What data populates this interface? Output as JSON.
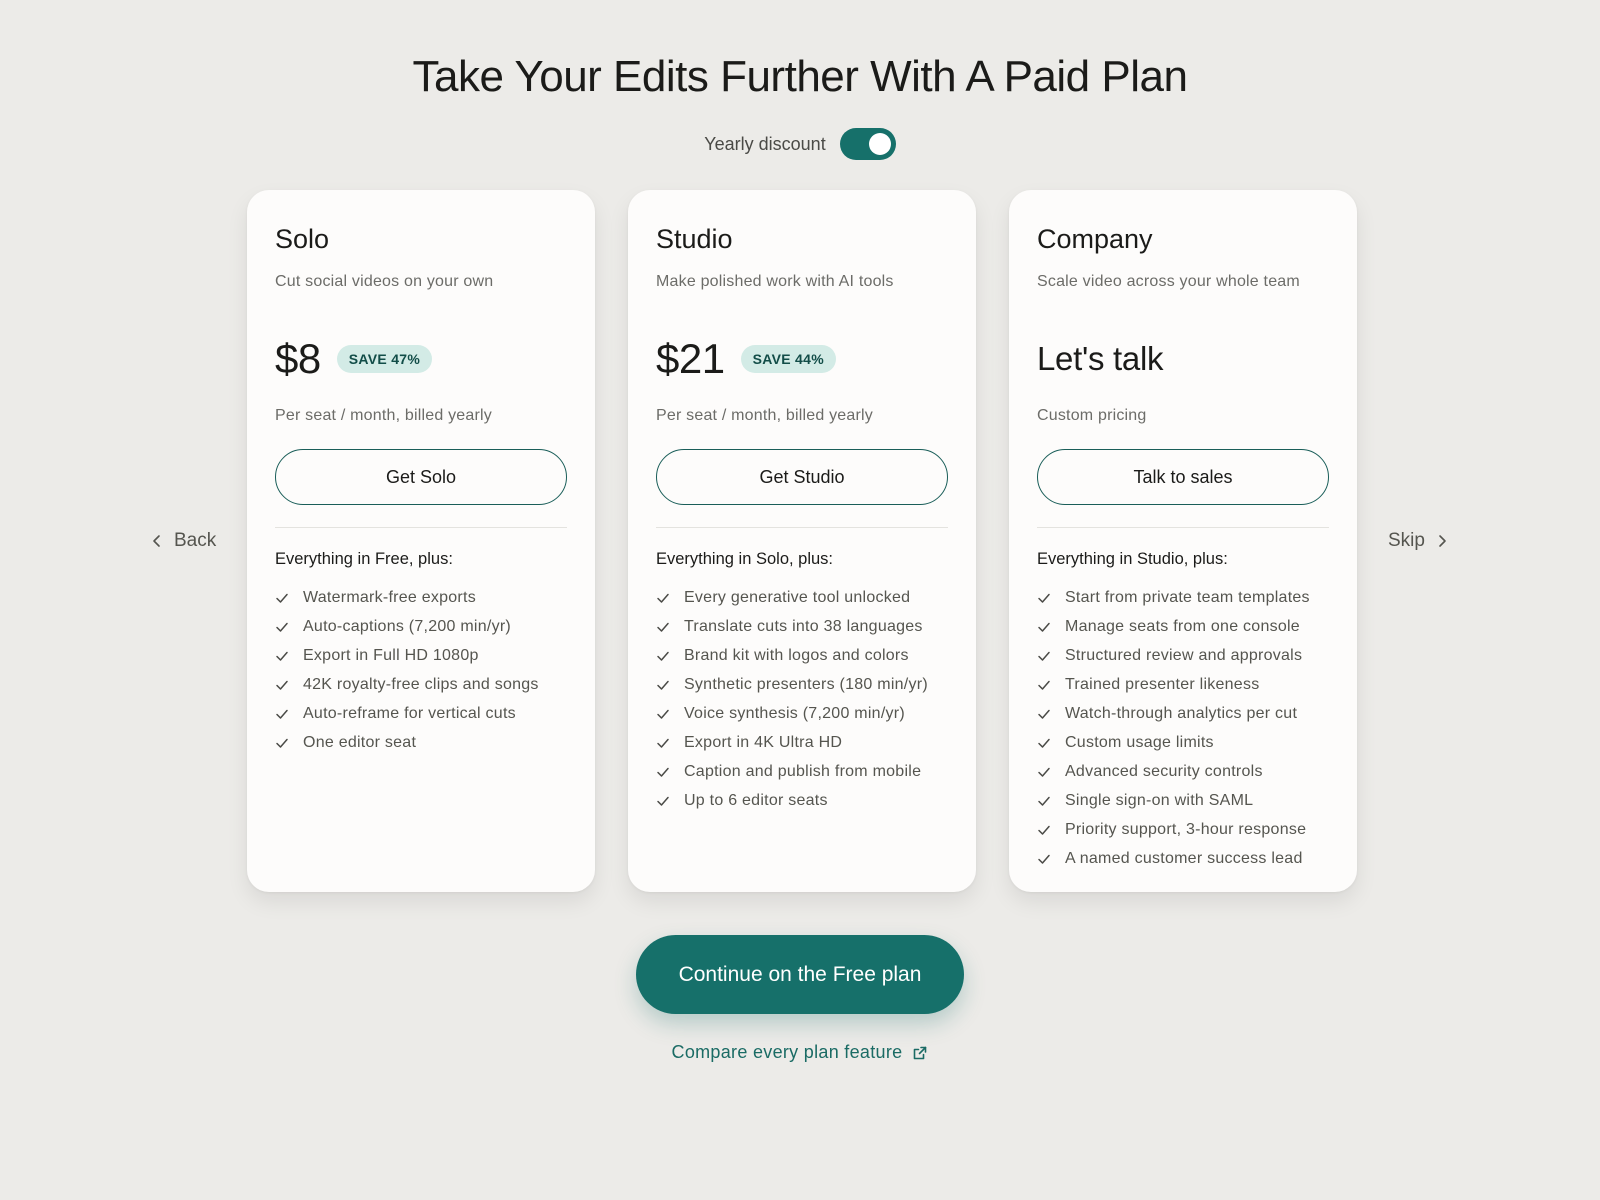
{
  "page": {
    "title": "Take Your Edits Further With A Paid Plan",
    "toggle_label": "Yearly discount",
    "toggle_on": true,
    "accent_color": "#16706a"
  },
  "plans": [
    {
      "name": "Solo",
      "description": "Cut social videos on your own",
      "price": "$8",
      "save_badge": "SAVE 47%",
      "billing": "Per seat / month, billed yearly",
      "cta": "Get Solo",
      "includes": "Everything in Free, plus:",
      "features": [
        "Watermark-free exports",
        "Auto-captions (7,200 min/yr)",
        "Export in Full HD 1080p",
        "42K royalty-free clips and songs",
        "Auto-reframe for vertical cuts",
        "One editor seat"
      ]
    },
    {
      "name": "Studio",
      "description": "Make polished work with AI tools",
      "price": "$21",
      "save_badge": "SAVE 44%",
      "billing": "Per seat / month, billed yearly",
      "cta": "Get Studio",
      "includes": "Everything in Solo, plus:",
      "features": [
        "Every generative tool unlocked",
        "Translate cuts into 38 languages",
        "Brand kit with logos and colors",
        "Synthetic presenters (180 min/yr)",
        "Voice synthesis (7,200 min/yr)",
        "Export in 4K Ultra HD",
        "Caption and publish from mobile",
        "Up to 6 editor seats"
      ]
    },
    {
      "name": "Company",
      "description": "Scale video across your whole team",
      "price": "Let's talk",
      "save_badge": "",
      "billing": "Custom pricing",
      "cta": "Talk to sales",
      "includes": "Everything in Studio, plus:",
      "features": [
        "Start from private team templates",
        "Manage seats from one console",
        "Structured review and approvals",
        "Trained presenter likeness",
        "Watch-through analytics per cut",
        "Custom usage limits",
        "Advanced security controls",
        "Single sign-on with SAML",
        "Priority support, 3-hour response",
        "A named customer success lead"
      ]
    }
  ],
  "nav": {
    "back_label": "Back",
    "skip_label": "Skip"
  },
  "footer": {
    "continue_label": "Continue on the Free plan",
    "compare_label": "Compare every plan feature"
  }
}
